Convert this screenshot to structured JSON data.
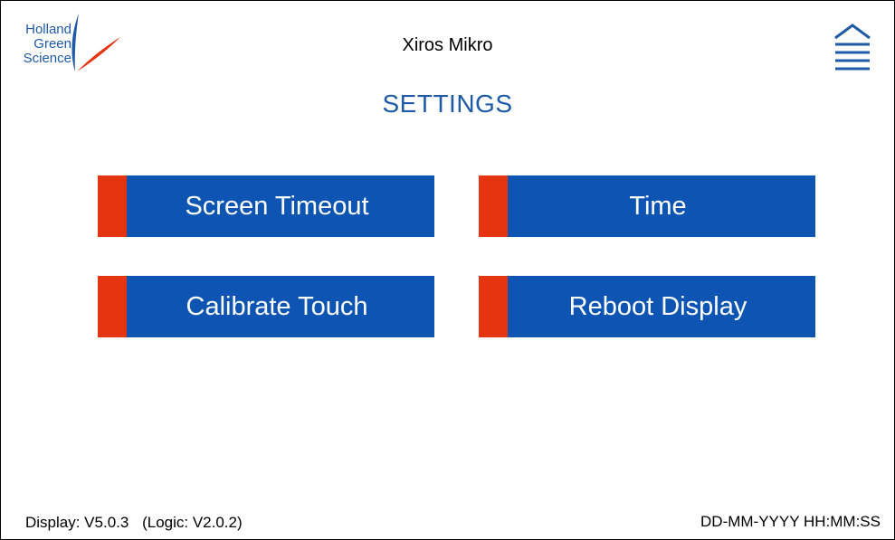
{
  "logo": {
    "lines": [
      "Holland",
      "Green",
      "Science"
    ]
  },
  "header": {
    "app_title": "Xiros Mikro",
    "menu_icon": "menu-icon"
  },
  "page": {
    "title": "SETTINGS"
  },
  "buttons": {
    "screen_timeout": "Screen Timeout",
    "time": "Time",
    "calibrate_touch": "Calibrate Touch",
    "reboot_display": "Reboot Display"
  },
  "footer": {
    "display_version": "Display: V5.0.3",
    "logic_version": "(Logic: V2.0.2)",
    "datetime": "DD-MM-YYYY HH:MM:SS"
  },
  "colors": {
    "button_blue": "#0e54b2",
    "accent_red": "#e53410",
    "title_blue": "#1f5aa6"
  }
}
